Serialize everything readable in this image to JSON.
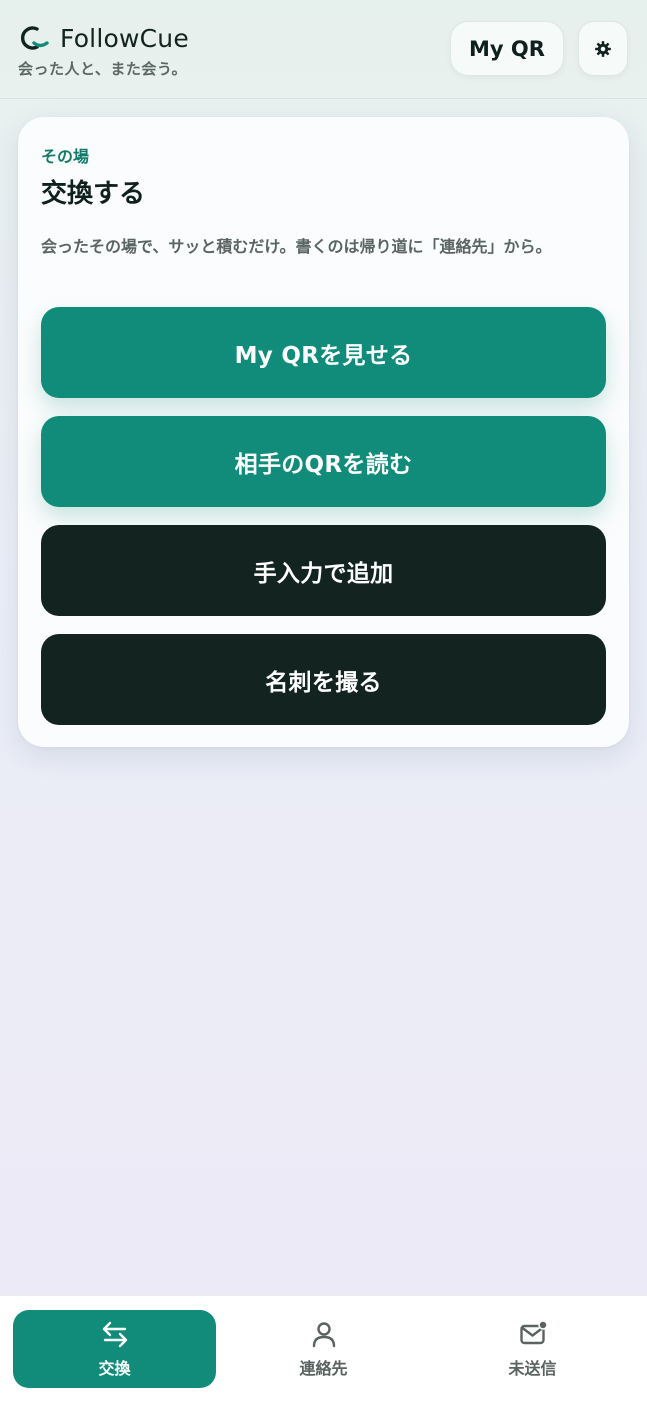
{
  "app": {
    "name": "FollowCue",
    "tagline": "会った人と、また会う。"
  },
  "header": {
    "myqr_label": "My QR",
    "settings_icon": "gear-icon"
  },
  "card": {
    "eyebrow": "その場",
    "title": "交換する",
    "description": "会ったその場で、サッと積むだけ。書くのは帰り道に「連絡先」から。",
    "actions": [
      {
        "label": "My QRを見せる",
        "style": "primary"
      },
      {
        "label": "相手のQRを読む",
        "style": "primary"
      },
      {
        "label": "手入力で追加",
        "style": "dark"
      },
      {
        "label": "名刺を撮る",
        "style": "dark"
      }
    ]
  },
  "nav": {
    "items": [
      {
        "label": "交換",
        "icon": "swap-arrows-icon",
        "active": true
      },
      {
        "label": "連絡先",
        "icon": "person-icon",
        "active": false
      },
      {
        "label": "未送信",
        "icon": "mail-badge-icon",
        "active": false
      }
    ]
  },
  "colors": {
    "accent": "#118c7b",
    "dark": "#122320",
    "eyebrow": "#137a68"
  }
}
